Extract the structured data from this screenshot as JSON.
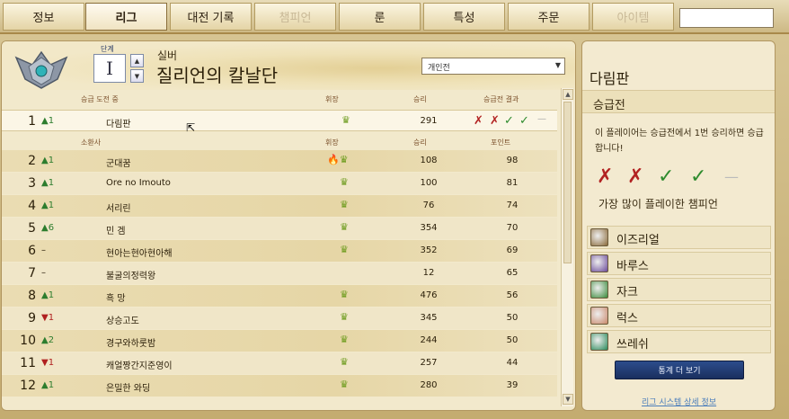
{
  "tabs": [
    {
      "label": "정보",
      "state": "normal"
    },
    {
      "label": "리그",
      "state": "active"
    },
    {
      "label": "대전 기록",
      "state": "normal"
    },
    {
      "label": "챔피언",
      "state": "disabled"
    },
    {
      "label": "룬",
      "state": "normal"
    },
    {
      "label": "특성",
      "state": "normal"
    },
    {
      "label": "주문",
      "state": "normal"
    },
    {
      "label": "아이템",
      "state": "disabled"
    }
  ],
  "league": {
    "tier_label": "단계",
    "division": "I",
    "up_arrow": "▲",
    "down_arrow": "▼",
    "tier_name": "실버",
    "league_name": "질리언의 칼날단",
    "queue": "개인전",
    "queue_arrow": "▼"
  },
  "series_header": {
    "col1": "승급 도전 중",
    "col_badge": "휘장",
    "col_wins": "승리",
    "col_result": "승급전 결과"
  },
  "series_row": {
    "rank": "1",
    "change": "▲1",
    "name": "다림판",
    "badge": "♛",
    "wins": "291",
    "results": [
      "✗",
      "✗",
      "✓",
      "✓",
      "—"
    ]
  },
  "table_header": {
    "col1": "소환사",
    "col_badge": "휘장",
    "col_wins": "승리",
    "col_points": "포인트"
  },
  "rows": [
    {
      "rank": "2",
      "change": "▲1",
      "name": "군대꿈",
      "badge": "🔥♛",
      "wins": "108",
      "points": "98"
    },
    {
      "rank": "3",
      "change": "▲1",
      "name": "Ore no Imouto",
      "badge": "♛",
      "wins": "100",
      "points": "81"
    },
    {
      "rank": "4",
      "change": "▲1",
      "name": "서리린",
      "badge": "♛",
      "wins": "76",
      "points": "74"
    },
    {
      "rank": "5",
      "change": "▲6",
      "name": "민 겜",
      "badge": "♛",
      "wins": "354",
      "points": "70"
    },
    {
      "rank": "6",
      "change": "–",
      "name": "현아는현아현아해",
      "badge": "♛",
      "wins": "352",
      "points": "69"
    },
    {
      "rank": "7",
      "change": "–",
      "name": "불굴의정력왕",
      "badge": "",
      "wins": "12",
      "points": "65"
    },
    {
      "rank": "8",
      "change": "▲1",
      "name": "흑 망",
      "badge": "♛",
      "wins": "476",
      "points": "56"
    },
    {
      "rank": "9",
      "change": "▼1",
      "name": "상승고도",
      "badge": "♛",
      "wins": "345",
      "points": "50"
    },
    {
      "rank": "10",
      "change": "▲2",
      "name": "경구와하룻밤",
      "badge": "♛",
      "wins": "244",
      "points": "50"
    },
    {
      "rank": "11",
      "change": "▼1",
      "name": "캐얼짱간지준영이",
      "badge": "♛",
      "wins": "257",
      "points": "44"
    },
    {
      "rank": "12",
      "change": "▲1",
      "name": "은밀한 와딩",
      "badge": "♛",
      "wins": "280",
      "points": "39"
    }
  ],
  "scroll": {
    "up": "▲",
    "down": "▼"
  },
  "side": {
    "player": "다림판",
    "subtitle": "승급전",
    "message": "이 플레이어는 승급전에서 1번 승리하면 승급합니다!",
    "marks": [
      "✗",
      "✗",
      "✓",
      "✓",
      "—"
    ],
    "most_played_label": "가장 많이 플레이한 챔피언",
    "champions": [
      {
        "name": "이즈리얼",
        "color": "#8a6a3a"
      },
      {
        "name": "바루스",
        "color": "#6a4a9a"
      },
      {
        "name": "자크",
        "color": "#3a8a3a"
      },
      {
        "name": "럭스",
        "color": "#c9886a"
      },
      {
        "name": "쓰레쉬",
        "color": "#2a8a5a"
      }
    ],
    "more_button": "통계 더 보기",
    "info_link": "리그 시스템 상세 정보"
  },
  "colors": {
    "win": "#2e8b2e",
    "loss": "#b22222"
  }
}
